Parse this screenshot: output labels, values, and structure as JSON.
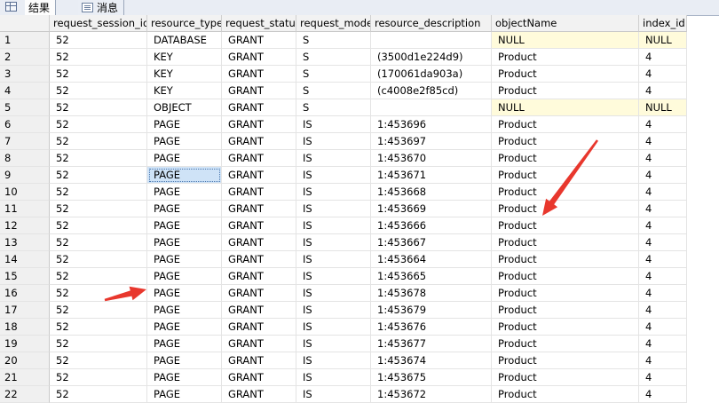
{
  "tabs": [
    {
      "label": "结果",
      "icon": "results-grid-icon"
    },
    {
      "label": "消息",
      "icon": "messages-icon"
    }
  ],
  "columns": [
    "",
    "request_session_id",
    "resource_type",
    "request_status",
    "request_mode",
    "resource_description",
    "objectName",
    "index_id"
  ],
  "rows": [
    [
      "1",
      "52",
      "DATABASE",
      "GRANT",
      "S",
      "",
      "NULL",
      "NULL"
    ],
    [
      "2",
      "52",
      "KEY",
      "GRANT",
      "S",
      "(3500d1e224d9)",
      "Product",
      "4"
    ],
    [
      "3",
      "52",
      "KEY",
      "GRANT",
      "S",
      "(170061da903a)",
      "Product",
      "4"
    ],
    [
      "4",
      "52",
      "KEY",
      "GRANT",
      "S",
      "(c4008e2f85cd)",
      "Product",
      "4"
    ],
    [
      "5",
      "52",
      "OBJECT",
      "GRANT",
      "S",
      "",
      "NULL",
      "NULL"
    ],
    [
      "6",
      "52",
      "PAGE",
      "GRANT",
      "IS",
      "1:453696",
      "Product",
      "4"
    ],
    [
      "7",
      "52",
      "PAGE",
      "GRANT",
      "IS",
      "1:453697",
      "Product",
      "4"
    ],
    [
      "8",
      "52",
      "PAGE",
      "GRANT",
      "IS",
      "1:453670",
      "Product",
      "4"
    ],
    [
      "9",
      "52",
      "PAGE",
      "GRANT",
      "IS",
      "1:453671",
      "Product",
      "4"
    ],
    [
      "10",
      "52",
      "PAGE",
      "GRANT",
      "IS",
      "1:453668",
      "Product",
      "4"
    ],
    [
      "11",
      "52",
      "PAGE",
      "GRANT",
      "IS",
      "1:453669",
      "Product",
      "4"
    ],
    [
      "12",
      "52",
      "PAGE",
      "GRANT",
      "IS",
      "1:453666",
      "Product",
      "4"
    ],
    [
      "13",
      "52",
      "PAGE",
      "GRANT",
      "IS",
      "1:453667",
      "Product",
      "4"
    ],
    [
      "14",
      "52",
      "PAGE",
      "GRANT",
      "IS",
      "1:453664",
      "Product",
      "4"
    ],
    [
      "15",
      "52",
      "PAGE",
      "GRANT",
      "IS",
      "1:453665",
      "Product",
      "4"
    ],
    [
      "16",
      "52",
      "PAGE",
      "GRANT",
      "IS",
      "1:453678",
      "Product",
      "4"
    ],
    [
      "17",
      "52",
      "PAGE",
      "GRANT",
      "IS",
      "1:453679",
      "Product",
      "4"
    ],
    [
      "18",
      "52",
      "PAGE",
      "GRANT",
      "IS",
      "1:453676",
      "Product",
      "4"
    ],
    [
      "19",
      "52",
      "PAGE",
      "GRANT",
      "IS",
      "1:453677",
      "Product",
      "4"
    ],
    [
      "20",
      "52",
      "PAGE",
      "GRANT",
      "IS",
      "1:453674",
      "Product",
      "4"
    ],
    [
      "21",
      "52",
      "PAGE",
      "GRANT",
      "IS",
      "1:453675",
      "Product",
      "4"
    ],
    [
      "22",
      "52",
      "PAGE",
      "GRANT",
      "IS",
      "1:453672",
      "Product",
      "4"
    ]
  ],
  "null_highlight_rows": [
    1,
    5
  ],
  "selected_cell": {
    "row": 9,
    "column": "resource_type"
  },
  "colors": {
    "null_background": "#fffbdb",
    "selected_background": "#cfe3f7",
    "annotation_arrow": "#e8372d",
    "header_background": "#f2f2f2"
  },
  "annotations": [
    {
      "type": "arrow",
      "icon": "red-arrow-icon",
      "points_to": "row 16 resource_type"
    },
    {
      "type": "arrow",
      "icon": "red-arrow-icon",
      "points_to": "row 11 objectName"
    }
  ]
}
